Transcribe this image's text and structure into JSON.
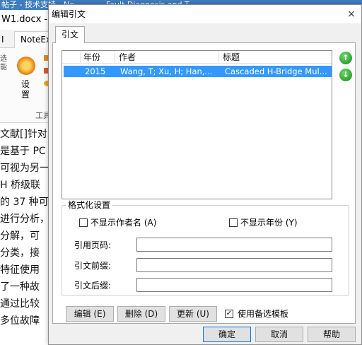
{
  "background": {
    "titlebar_left": "帖子 - 技术支持 - Ne",
    "titlebar_right": "Fault Diagnosis and T",
    "doc_title": "W1.docx - N",
    "tab_left": "I",
    "tab_note": "NoteEx",
    "settings_label": "设置",
    "group_label": "工具",
    "left_glyph": "选 能",
    "text_lines": [
      "文献[]针对",
      "是基于 PC",
      "可视为另一",
      "H 桥级联",
      "的 37 种可",
      "进行分析，",
      "分解，可",
      "分类，接",
      "特征使用",
      "了一种故",
      "通过比较",
      "多位故障"
    ]
  },
  "dialog": {
    "title": "编辑引文",
    "close": "×",
    "tab_label": "引文",
    "columns": [
      "年份",
      "作者",
      "标题"
    ],
    "rows": [
      {
        "year": "2015",
        "author": "Wang, T; Xu, H; Han,...",
        "title": "Cascaded H-Bridge Mul..."
      }
    ],
    "up_arrow": "↑",
    "down_arrow": "↓",
    "format_legend": "格式化设置",
    "hide_author_label": "不显示作者名 (A)",
    "hide_year_label": "不显示年份 (Y)",
    "cite_pages_label": "引用页码:",
    "cite_prefix_label": "引文前缀:",
    "cite_suffix_label": "引文后缀:",
    "cite_pages_value": "",
    "cite_prefix_value": "",
    "cite_suffix_value": "",
    "edit_button": "编辑 (E)",
    "delete_button": "删除 (D)",
    "update_button": "更新 (U)",
    "use_alt_template_label": "使用备选模板",
    "use_alt_template_checked": "✓",
    "ok_button": "确定",
    "cancel_button": "取消",
    "help_button": "帮助"
  }
}
